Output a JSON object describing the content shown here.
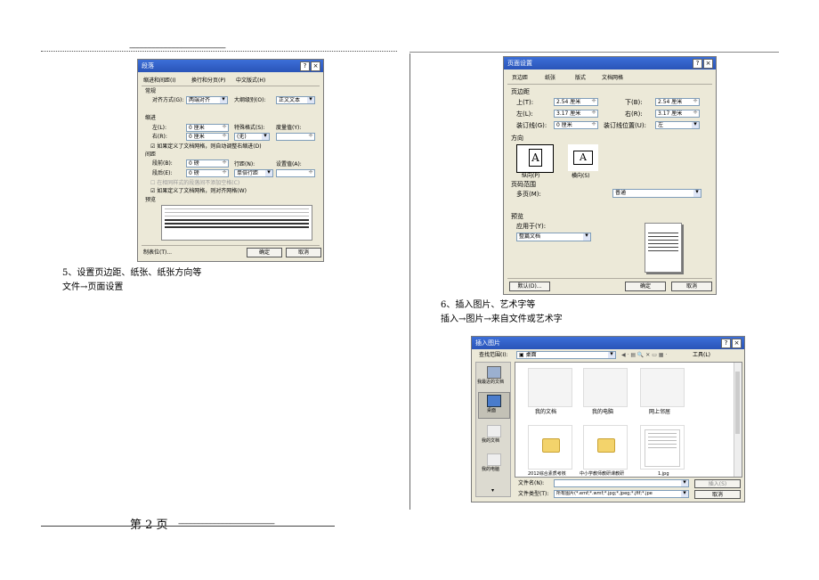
{
  "header": {
    "dashes": "------------------------------------------------"
  },
  "footer": {
    "page_label": "第 2 页",
    "dashes": "------------------------------------------------"
  },
  "left": {
    "caption1": "5、设置页边距、纸张、纸张方向等",
    "caption2": "文件→页面设置"
  },
  "right": {
    "caption1": "6、插入图片、艺术字等",
    "caption2": "插入→图片→来自文件或艺术字"
  },
  "para_dialog": {
    "title": "段落",
    "tabs": [
      "缩进和间距(I)",
      "换行和分页(P)",
      "中文版式(H)"
    ],
    "group_general": "常规",
    "align_label": "对齐方式(G):",
    "align_value": "两端对齐",
    "outline_label": "大纲级别(O):",
    "outline_value": "正文文本",
    "group_indent": "缩进",
    "left_label": "左(L):",
    "left_value": "0 厘米",
    "right_label": "右(R):",
    "right_value": "0 厘米",
    "special_label": "特殊格式(S):",
    "special_value": "(无)",
    "measure_label": "度量值(Y):",
    "indent_check": "如果定义了文档网格，则自动调整右缩进(D)",
    "group_spacing": "间距",
    "before_label": "段前(B):",
    "before_value": "0 磅",
    "after_label": "段后(E):",
    "after_value": "0 磅",
    "line_label": "行距(N):",
    "line_value": "单倍行距",
    "setting_label": "设置值(A):",
    "same_style_check": "在相同样式的段落间不添加空格(C)",
    "grid_check": "如果定义了文档网格，则对齐网格(W)",
    "preview_label": "预览",
    "tabs_button": "制表位(T)...",
    "ok": "确定",
    "cancel": "取消"
  },
  "page_dialog": {
    "title": "页面设置",
    "tabs": [
      "页边距",
      "纸张",
      "版式",
      "文档网格"
    ],
    "group_margin": "页边距",
    "top_label": "上(T):",
    "top_value": "2.54 厘米",
    "bottom_label": "下(B):",
    "bottom_value": "2.54 厘米",
    "left_label": "左(L):",
    "left_value": "3.17 厘米",
    "right_label": "右(R):",
    "right_value": "3.17 厘米",
    "gutter_label": "装订线(G):",
    "gutter_value": "0 厘米",
    "gutter_pos_label": "装订线位置(U):",
    "gutter_pos_value": "左",
    "group_orient": "方向",
    "portrait": "纵向(P)",
    "landscape": "横向(S)",
    "group_pages": "页码范围",
    "multi_label": "多页(M):",
    "multi_value": "普通",
    "group_preview": "预览",
    "apply_label": "应用于(Y):",
    "apply_value": "整篇文档",
    "default_button": "默认(D)...",
    "ok": "确定",
    "cancel": "取消"
  },
  "insert_dialog": {
    "title": "插入图片",
    "lookin_label": "查找范围(I):",
    "lookin_value": "桌面",
    "tools_label": "工具(L)",
    "places": [
      "我最近的文档",
      "桌面",
      "我的文档",
      "我的电脑"
    ],
    "items": [
      "我的文档",
      "我的电脑",
      "网上邻居",
      "2012综合素质考核",
      "中小学教师教研课教研",
      "1.jpg"
    ],
    "filename_label": "文件名(N):",
    "filetype_label": "文件类型(T):",
    "filetype_value": "所有图片(*.emf;*.wmf;*.jpg;*.jpeg;*.jfif;*.jpe",
    "insert_button": "插入(S)",
    "cancel": "取消"
  }
}
